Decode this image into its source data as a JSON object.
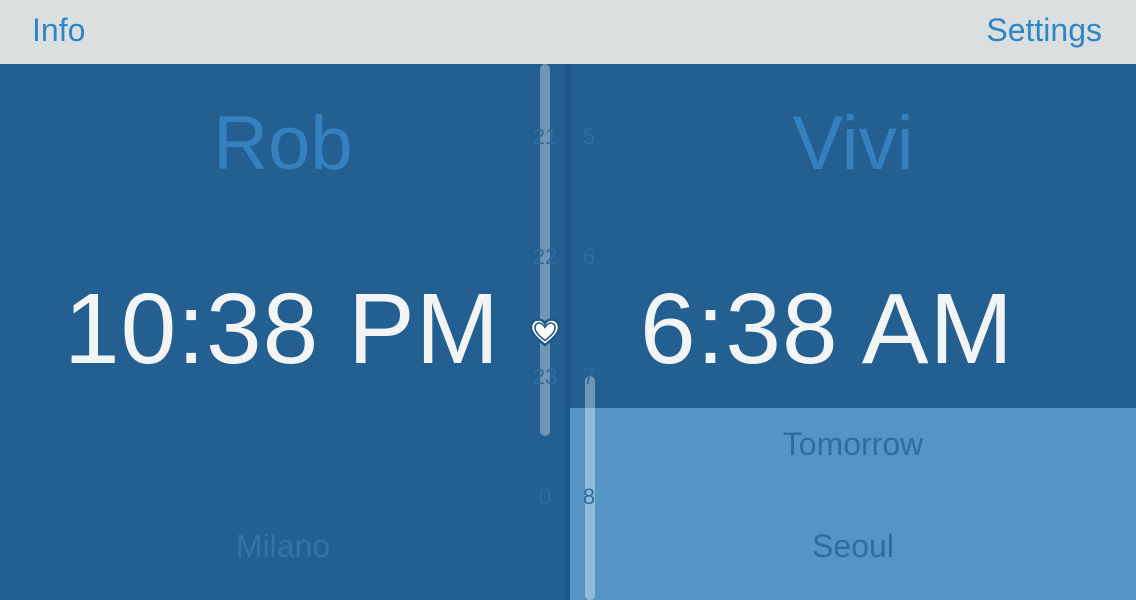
{
  "topbar": {
    "info_label": "Info",
    "settings_label": "Settings"
  },
  "left_person": {
    "name": "Rob",
    "time": "10:38 PM",
    "city": "Milano"
  },
  "right_person": {
    "name": "Vivi",
    "time": "6:38 AM",
    "day": "Tomorrow",
    "city": "Seoul"
  },
  "hour_ticks": {
    "left": [
      "21",
      "22",
      "23",
      "0"
    ],
    "right": [
      "5",
      "6",
      "7",
      "8"
    ]
  },
  "icons": {
    "center": "heart-icon"
  },
  "colors": {
    "accent": "#2d86c8",
    "background": "#245f91",
    "tomorrow_highlight": "#5595c4",
    "time_text": "#f2f4f5"
  }
}
